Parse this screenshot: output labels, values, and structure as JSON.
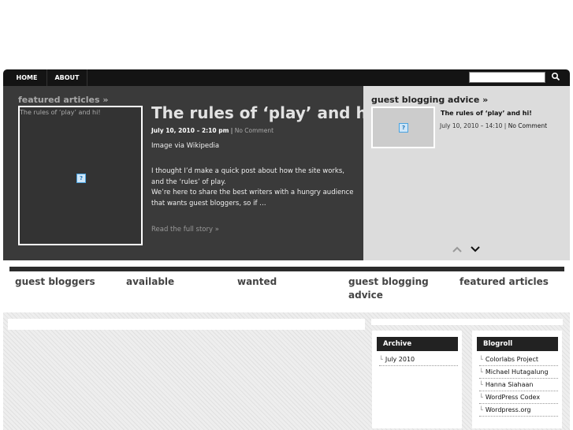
{
  "nav": {
    "items": [
      {
        "label": "HOME"
      },
      {
        "label": "ABOUT"
      }
    ],
    "search": {
      "placeholder": "",
      "value": ""
    }
  },
  "featured": {
    "heading": "featured articles »",
    "image_alt": "The rules of ‘play’ and hi!",
    "title": "The rules of ‘play’ and hi!",
    "date": "July 10, 2010 – 2:10 pm",
    "separator": " | ",
    "comments": "No Comment",
    "paragraph1": "Image via Wikipedia",
    "paragraph2": "I thought I’d make a quick post about how the site works, and the ‘rules’ of play.",
    "paragraph3": "We’re here to share the best writers with a hungry audience that wants guest bloggers, so if …",
    "read_more": "Read the full story »"
  },
  "advice": {
    "heading": "guest blogging advice »",
    "post_title": "The rules of ‘play’ and hi!",
    "post_date": "July 10, 2010 – 14:10",
    "separator": " | ",
    "comments": "No Comment"
  },
  "categories": [
    {
      "label": "guest bloggers"
    },
    {
      "label": "available"
    },
    {
      "label": "wanted"
    },
    {
      "label": "guest blogging advice"
    },
    {
      "label": "featured articles"
    }
  ],
  "widgets": {
    "archive": {
      "title": "Archive",
      "items": [
        {
          "label": "July 2010"
        }
      ]
    },
    "blogroll": {
      "title": "Blogroll",
      "items": [
        {
          "label": "Colorlabs Project"
        },
        {
          "label": "Michael Hutagalung"
        },
        {
          "label": "Hanna Siahaan"
        },
        {
          "label": "WordPress Codex"
        },
        {
          "label": "Wordpress.org"
        }
      ]
    }
  },
  "icons": {
    "search": "search-icon",
    "broken_image": "broken-image-icon",
    "arrow_up": "arrow-up-icon",
    "arrow_down": "arrow-down-icon"
  },
  "colors": {
    "nav_bg": "#141414",
    "featured_bg": "#3a3a3a",
    "advice_bg": "#dcdcdc",
    "widget_title_bg": "#222222"
  }
}
